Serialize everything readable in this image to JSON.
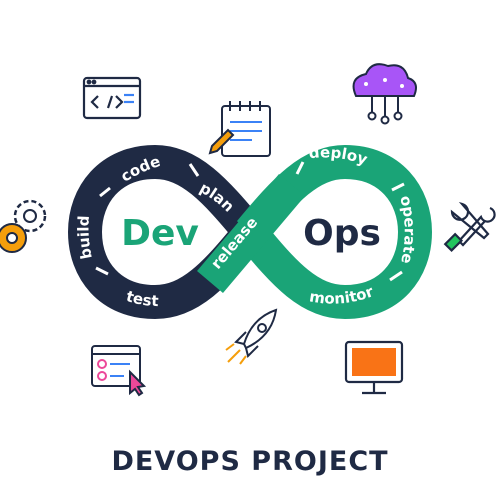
{
  "diagram": {
    "left_word": "Dev",
    "right_word": "Ops",
    "stages": {
      "code": "code",
      "plan": "plan",
      "build": "build",
      "test": "test",
      "release": "release",
      "deploy": "deploy",
      "operate": "operate",
      "monitor": "monitor"
    },
    "colors": {
      "navy": "#1f2a44",
      "green": "#1aa477",
      "accent": "#f59e0b"
    }
  },
  "icons": [
    "code-window-icon",
    "notepad-icon",
    "cloud-network-icon",
    "gears-icon",
    "tools-icon",
    "rocket-icon",
    "checklist-icon",
    "monitor-icon"
  ],
  "caption": "DEVOPS PROJECT"
}
